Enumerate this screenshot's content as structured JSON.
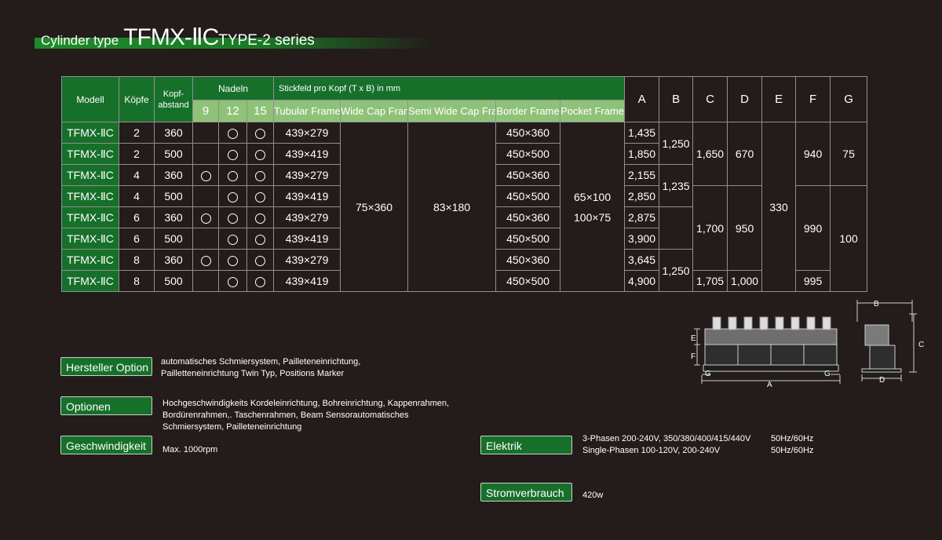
{
  "header": {
    "prefix": "Cylinder type",
    "model": "TFMX-ⅡC",
    "series": "TYPE-2 series"
  },
  "table": {
    "col_modell": "Modell",
    "col_koepfe": "Köpfe",
    "col_kopfabstand_1": "Kopf-",
    "col_kopfabstand_2": "abstand",
    "col_nadeln": "Nadeln",
    "needles": [
      "9",
      "12",
      "15"
    ],
    "col_stickfeld": "Stickfeld pro Kopf (T x B) in mm",
    "frames": [
      "Tubular Frame",
      "Wide Cap Frame",
      "Semi Wide Cap Frame",
      "Border Frame",
      "Pocket Frame"
    ],
    "dims": [
      "A",
      "B",
      "C",
      "D",
      "E",
      "F",
      "G"
    ],
    "rows": [
      {
        "model": "TFMX-ⅡC",
        "heads": "2",
        "spacing": "360",
        "tubular": "439×279",
        "border": "450×360",
        "A": "1,435"
      },
      {
        "model": "TFMX-ⅡC",
        "heads": "2",
        "spacing": "500",
        "tubular": "439×419",
        "border": "450×500",
        "A": "1,850"
      },
      {
        "model": "TFMX-ⅡC",
        "heads": "4",
        "spacing": "360",
        "tubular": "439×279",
        "border": "450×360",
        "A": "2,155"
      },
      {
        "model": "TFMX-ⅡC",
        "heads": "4",
        "spacing": "500",
        "tubular": "439×419",
        "border": "450×500",
        "A": "2,850"
      },
      {
        "model": "TFMX-ⅡC",
        "heads": "6",
        "spacing": "360",
        "tubular": "439×279",
        "border": "450×360",
        "A": "2,875"
      },
      {
        "model": "TFMX-ⅡC",
        "heads": "6",
        "spacing": "500",
        "tubular": "439×419",
        "border": "450×500",
        "A": "3,900"
      },
      {
        "model": "TFMX-ⅡC",
        "heads": "8",
        "spacing": "360",
        "tubular": "439×279",
        "border": "450×360",
        "A": "3,645"
      },
      {
        "model": "TFMX-ⅡC",
        "heads": "8",
        "spacing": "500",
        "tubular": "439×419",
        "border": "450×500",
        "A": "4,900"
      }
    ],
    "needle_marks": [
      [
        false,
        true,
        true
      ],
      [
        false,
        true,
        true
      ],
      [
        true,
        true,
        true
      ],
      [
        false,
        true,
        true
      ],
      [
        true,
        true,
        true
      ],
      [
        false,
        true,
        true
      ],
      [
        true,
        true,
        true
      ],
      [
        false,
        true,
        true
      ]
    ],
    "wide_cap": "75×360",
    "semi_wide_cap": "83×180",
    "pocket_1": "65×100",
    "pocket_2": "100×75",
    "B_values": [
      "1,250",
      "1,235",
      "1,250"
    ],
    "C_values": [
      "1,650",
      "1,700",
      "1,705"
    ],
    "D_values": [
      "670",
      "950",
      "1,000"
    ],
    "E_value": "330",
    "F_values": [
      "940",
      "990",
      "995"
    ],
    "G_values": [
      "75",
      "100"
    ]
  },
  "options": {
    "hersteller_label": "Hersteller Option",
    "hersteller_text_1": "automatisches Schmiersystem, Pailleteneinrichtung,",
    "hersteller_text_2": "Pailletteneinrichtung Twin Typ, Positions Marker",
    "optionen_label": "Optionen",
    "optionen_text_1": "Hochgeschwindigkeits Kordeleinrichtung, Bohreinrichtung, Kappenrahmen,",
    "optionen_text_2": "Bordürenrahmen,. Taschenrahmen, Beam Sensorautomatisches",
    "optionen_text_3": "Schmiersystem, Pailleteneinrichtung",
    "geschwindigkeit_label": "Geschwindigkeit",
    "geschwindigkeit_text": "Max. 1000rpm",
    "elektrik_label": "Elektrik",
    "elektrik_text_1": "3-Phasen 200-240V, 350/380/400/415/440V",
    "elektrik_text_2": "Single-Phasen 100-120V, 200-240V",
    "elektrik_hz_1": "50Hz/60Hz",
    "elektrik_hz_2": "50Hz/60Hz",
    "strom_label": "Stromverbrauch",
    "strom_text": "420w"
  },
  "diagram": {
    "labels": [
      "A",
      "B",
      "C",
      "D",
      "E",
      "F",
      "G",
      "G"
    ]
  },
  "colors": {
    "background": "#231c1a",
    "green": "#17702a",
    "light_green": "#8fc279"
  }
}
